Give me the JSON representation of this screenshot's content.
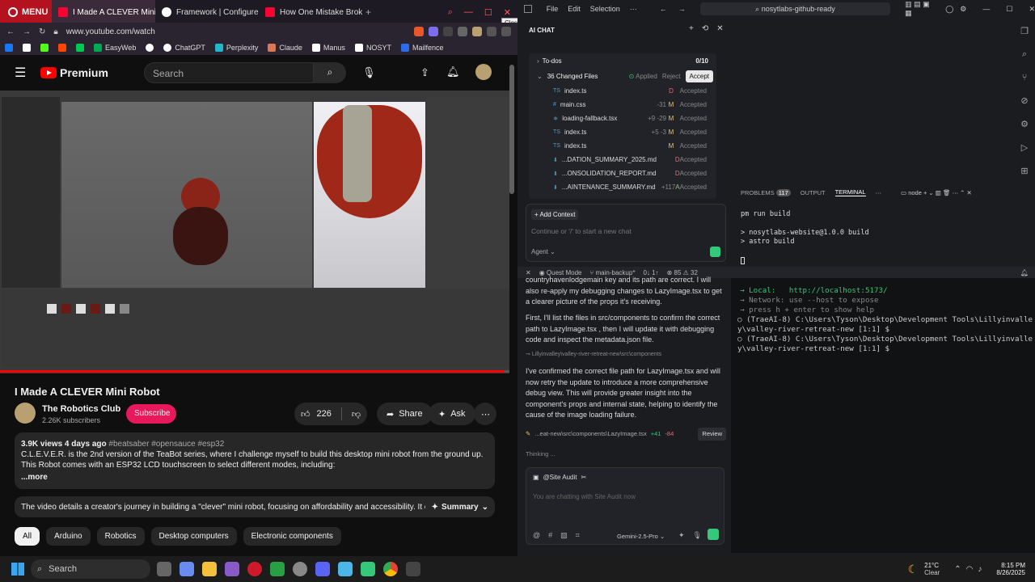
{
  "browser": {
    "menu_label": "MENU",
    "tabs": [
      {
        "title": "I Made A CLEVER Mini",
        "color": "#ff0033"
      },
      {
        "title": "Framework | Configure F",
        "color": "#ffffff"
      },
      {
        "title": "How One Mistake Broke C",
        "color": "#ff0033"
      }
    ],
    "close_tooltip": "Close",
    "url": "www.youtube.com/watch",
    "bookmarks": [
      {
        "label": "",
        "color": "#1877f2"
      },
      {
        "label": "",
        "color": "#ffffff"
      },
      {
        "label": "",
        "color": "#53fc18"
      },
      {
        "label": "",
        "color": "#ff4500"
      },
      {
        "label": "",
        "color": "#00c853"
      },
      {
        "label": "EasyWeb",
        "color": "#00aa55"
      },
      {
        "label": "",
        "color": "#ffffff"
      },
      {
        "label": "ChatGPT",
        "color": "#ffffff"
      },
      {
        "label": "Perplexity",
        "color": "#20b8cd"
      },
      {
        "label": "Claude",
        "color": "#d97757"
      },
      {
        "label": "Manus",
        "color": "#ffffff"
      },
      {
        "label": "NOSYT",
        "color": "#ffffff"
      },
      {
        "label": "Mailfence",
        "color": "#2c6bed"
      }
    ]
  },
  "youtube": {
    "premium_label": "Premium",
    "search_placeholder": "Search",
    "video_title": "I Made A CLEVER Mini Robot",
    "channel_name": "The Robotics Club",
    "subscribers": "2.26K subscribers",
    "subscribe_label": "Subscribe",
    "likes": "226",
    "share_label": "Share",
    "ask_label": "Ask",
    "views_line": "3.9K views  4 days ago",
    "hashtags": "#beatsaber #opensauce #esp32",
    "description": "C.L.E.V.E.R. is the 2nd version of the TeaBot series, where I challenge myself to build this desktop mini robot from the ground up. This Robot comes with an ESP32 LCD touchscreen to select different modes, including:",
    "more_label": "...more",
    "summary_text": "The video details a creator's journey in building a \"clever\" mini robot, focusing on affordability and accessibility. It covers...",
    "summary_label": "Summary",
    "chips": [
      "All",
      "Arduino",
      "Robotics",
      "Desktop computers",
      "Electronic components"
    ]
  },
  "editor": {
    "menu": [
      "File",
      "Edit",
      "Selection",
      "···"
    ],
    "search_text": "nosytlabs-github-ready",
    "chat_header": "AI CHAT",
    "todos_label": "To-dos",
    "todos_count": "0/10",
    "changed_files_label": "36 Changed Files",
    "applied_label": "Applied",
    "reject_label": "Reject",
    "accept_label": "Accept",
    "files": [
      {
        "name": "index.ts",
        "diff": "",
        "status": "D",
        "state": "Accepted",
        "status_color": "#e06c75"
      },
      {
        "name": "main.css",
        "diff": "-31",
        "status": "M",
        "state": "Accepted",
        "status_color": "#e5c07b"
      },
      {
        "name": "loading-fallback.tsx",
        "diff": "+9 -29",
        "status": "M",
        "state": "Accepted",
        "status_color": "#e5c07b"
      },
      {
        "name": "index.ts",
        "diff": "+5 -3",
        "status": "M",
        "state": "Accepted",
        "status_color": "#e5c07b"
      },
      {
        "name": "index.ts",
        "diff": "",
        "status": "M",
        "state": "Accepted",
        "status_color": "#e5c07b"
      },
      {
        "name": "...DATION_SUMMARY_2025.md",
        "diff": "",
        "status": "D",
        "state": "Accepted",
        "status_color": "#e06c75"
      },
      {
        "name": "...ONSOLIDATION_REPORT.md",
        "diff": "",
        "status": "D",
        "state": "Accepted",
        "status_color": "#e06c75"
      },
      {
        "name": "...AINTENANCE_SUMMARY.md",
        "diff": "+117",
        "status": "A",
        "state": "Accepted",
        "status_color": "#98c379"
      }
    ],
    "add_context_label": "+ Add Context",
    "chat_placeholder": "Continue or '/' to start a new chat",
    "agent_label": "Agent",
    "terminal_tabs": [
      "PROBLEMS",
      "OUTPUT",
      "TERMINAL"
    ],
    "problems_count": "117",
    "terminal_shell": "node",
    "terminal_lines": [
      "pm run build",
      "",
      "> nosytlabs-website@1.0.0 build",
      "> astro build"
    ],
    "status_items": [
      "Quest Mode",
      "main-backup*",
      "0↓ 1↑",
      "85",
      "32"
    ],
    "chat_messages": [
      "countryhavenlodgemain key and its path are correct. I will also re-apply my debugging changes to LazyImage.tsx to get a clearer picture of the props it's receiving.",
      "First, I'll list the files in src/components to confirm the correct path to LazyImage.tsx , then I will update it with debugging code and inspect the metadata.json file.",
      "I've confirmed the correct file path for LazyImage.tsx and will now retry the update to introduce a more comprehensive debug view. This will provide greater insight into the component's props and internal state, helping to identify the cause of the image loading failure."
    ],
    "path_line": "Lillyinvalley\\valley-river-retreat-new\\src\\components",
    "edit_file": "...eat-new\\src\\components\\LazyImage.tsx",
    "edit_add": "+41",
    "edit_del": "-84",
    "review_label": "Review",
    "thinking_label": "Thinking ...",
    "site_audit_label": "@Site Audit",
    "site_audit_placeholder": "You are chatting with Site Audit now",
    "model_label": "Gemini-2.5-Pro",
    "term2_lines": [
      "  → Local:   http://localhost:5173/",
      "  → Network: use --host to expose",
      "  → press h + enter to show help",
      "○ (TraeAI-8) C:\\Users\\Tyson\\Desktop\\Development Tools\\Lillyinvalle",
      "y\\valley-river-retreat-new [1:1] $",
      "○ (TraeAI-8) C:\\Users\\Tyson\\Desktop\\Development Tools\\Lillyinvalle",
      "y\\valley-river-retreat-new [1:1] $ "
    ]
  },
  "taskbar": {
    "search_label": "Search",
    "weather_temp": "21°C",
    "weather_desc": "Clear",
    "time": "8:15 PM",
    "date": "8/26/2025"
  }
}
